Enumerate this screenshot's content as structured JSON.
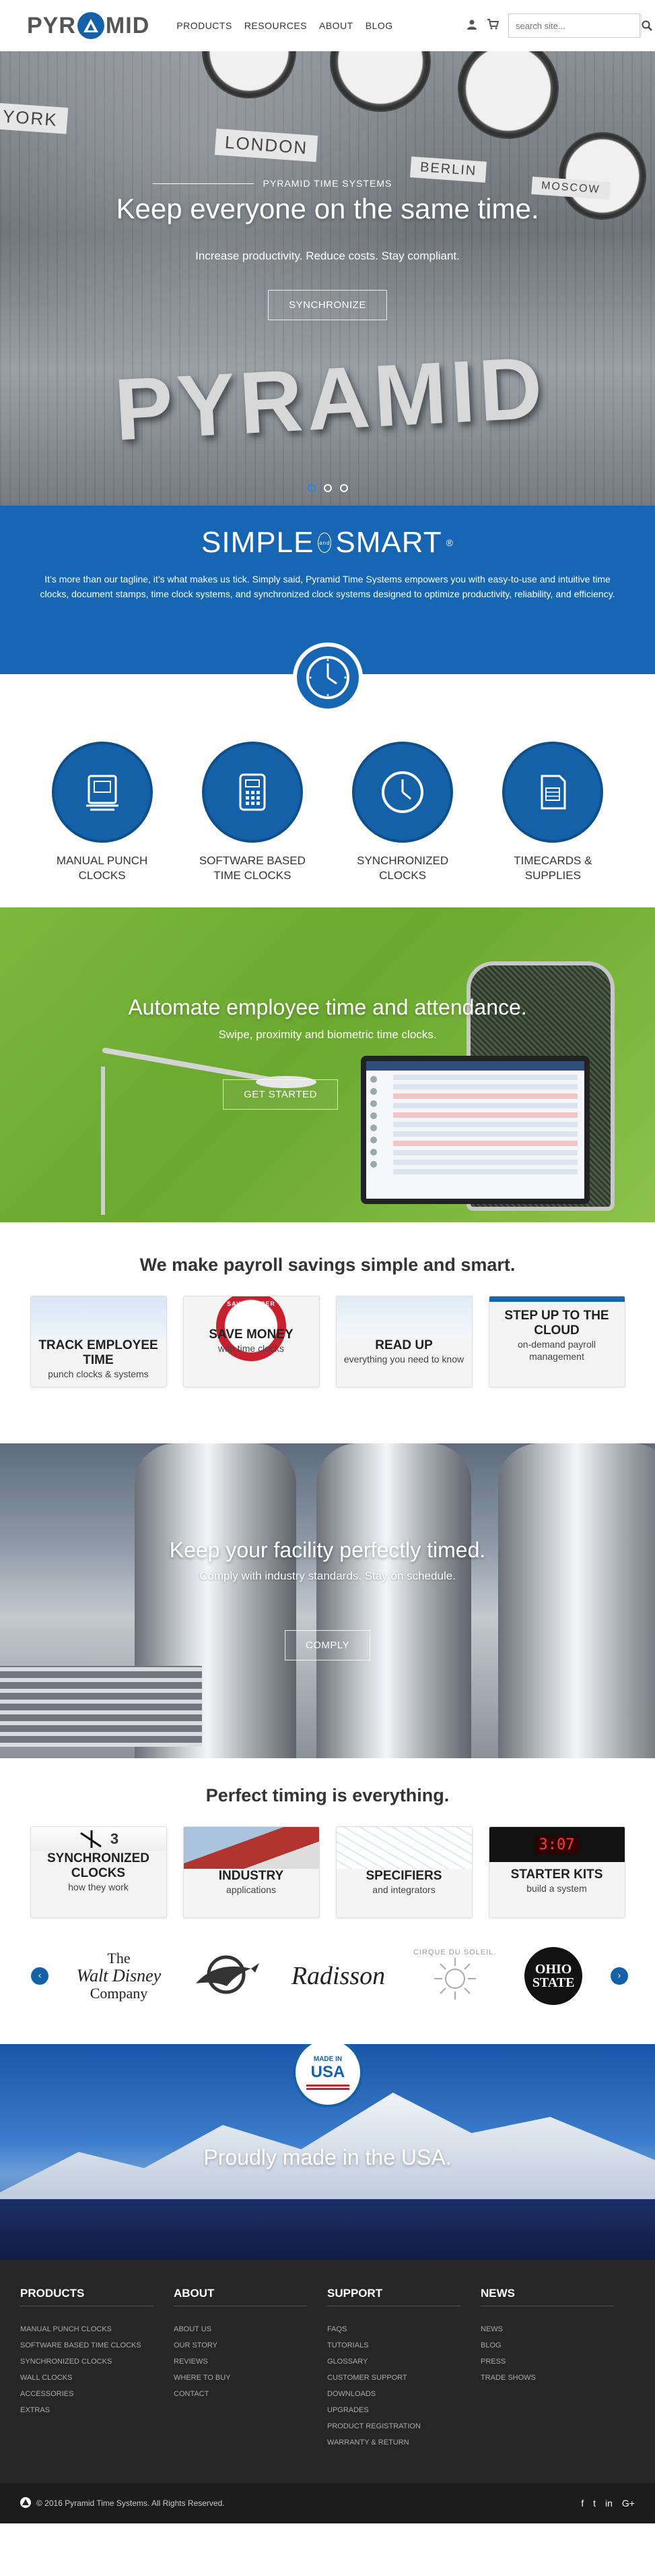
{
  "header": {
    "logo_text_left": "PYR",
    "logo_text_right": "MID",
    "nav": [
      "PRODUCTS",
      "RESOURCES",
      "ABOUT",
      "BLOG"
    ],
    "search_placeholder": "search site..."
  },
  "hero": {
    "eyebrow": "PYRAMID TIME SYSTEMS",
    "title": "Keep everyone on the same time.",
    "subtitle": "Increase productivity. Reduce costs. Stay compliant.",
    "button": "SYNCHRONIZE",
    "city_labels": [
      "YORK",
      "LONDON",
      "BERLIN",
      "MOSCOW"
    ],
    "background_word": "PYRAMID",
    "slides": 3,
    "active_slide": 1
  },
  "smart": {
    "title_left": "SIMPLE",
    "title_and_1": "and",
    "title_right": "SMART",
    "reg": "®",
    "body": "It’s more than our tagline, it’s what makes us tick. Simply said, Pyramid Time Systems empowers you with easy-to-use and intuitive time clocks, document stamps, time clock systems, and synchronized clock systems designed to optimize productivity, reliability, and efficiency."
  },
  "categories": [
    {
      "label": "MANUAL PUNCH CLOCKS",
      "icon": "punch-clock-icon"
    },
    {
      "label": "SOFTWARE BASED TIME CLOCKS",
      "icon": "keypad-clock-icon"
    },
    {
      "label": "SYNCHRONIZED CLOCKS",
      "icon": "wall-clock-icon"
    },
    {
      "label": "TIMECARDS & SUPPLIES",
      "icon": "timecard-icon"
    }
  ],
  "automate": {
    "title": "Automate employee time and attendance.",
    "subtitle": "Swipe, proximity and biometric time clocks.",
    "button": "GET STARTED"
  },
  "payroll": {
    "title": "We make payroll savings simple and smart.",
    "cards": [
      {
        "title": "TRACK EMPLOYEE TIME",
        "subtitle": "punch clocks & systems"
      },
      {
        "title": "SAVE MONEY",
        "subtitle": "with time clocks",
        "seal": "SAVINGS PER EMPLOYEE"
      },
      {
        "title": "READ UP",
        "subtitle": "everything you need to know"
      },
      {
        "title": "STEP UP TO THE CLOUD",
        "subtitle": "on-demand payroll management"
      }
    ]
  },
  "facility": {
    "title": "Keep your facility perfectly timed.",
    "subtitle": "Comply with industry standards. Stay on schedule.",
    "button": "COMPLY"
  },
  "timing": {
    "title": "Perfect timing is everything.",
    "cards": [
      {
        "title": "SYNCHRONIZED CLOCKS",
        "subtitle": "how they work",
        "pic_text": "3"
      },
      {
        "title": "INDUSTRY",
        "subtitle": "applications"
      },
      {
        "title": "SPECIFIERS",
        "subtitle": "and integrators"
      },
      {
        "title": "STARTER KITS",
        "subtitle": "build a system",
        "pic_text": "3:07"
      }
    ]
  },
  "logos": {
    "disney_line1": "The",
    "disney_line2": "Walt Disney",
    "disney_line3": "Company",
    "radisson": "Radisson",
    "cirque": "CIRQUE DU SOLEIL.",
    "ohio": "OHIO STATE"
  },
  "usa": {
    "badge_top": "MADE IN",
    "badge_mid": "USA",
    "title": "Proudly made in the USA."
  },
  "footer": {
    "columns": [
      {
        "heading": "PRODUCTS",
        "links": [
          "MANUAL PUNCH CLOCKS",
          "SOFTWARE BASED TIME CLOCKS",
          "SYNCHRONIZED CLOCKS",
          "WALL CLOCKS",
          "ACCESSORIES",
          "EXTRAS"
        ]
      },
      {
        "heading": "ABOUT",
        "links": [
          "ABOUT US",
          "OUR STORY",
          "REVIEWS",
          "WHERE TO BUY",
          "CONTACT"
        ]
      },
      {
        "heading": "SUPPORT",
        "links": [
          "FAQS",
          "TUTORIALS",
          "GLOSSARY",
          "CUSTOMER SUPPORT",
          "DOWNLOADS",
          "UPGRADES",
          "PRODUCT REGISTRATION",
          "WARRANTY & RETURN"
        ]
      },
      {
        "heading": "NEWS",
        "links": [
          "NEWS",
          "BLOG",
          "PRESS",
          "TRADE SHOWS"
        ]
      }
    ],
    "copyright": "© 2016 Pyramid Time Systems. All Rights Reserved.",
    "social": [
      "f",
      "t",
      "in",
      "G+"
    ]
  },
  "colors": {
    "brand_blue": "#1766b3",
    "green": "#7cb83c",
    "footer": "#262626"
  }
}
